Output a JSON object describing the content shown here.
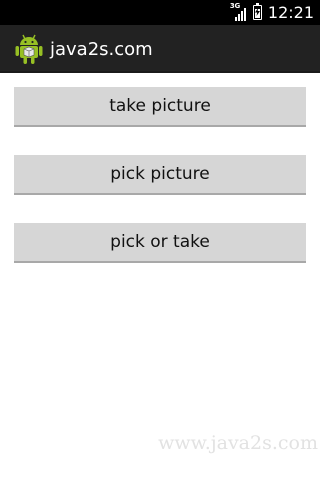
{
  "status_bar": {
    "network_type": "3G",
    "time": "12:21",
    "battery_level": 0.85
  },
  "action_bar": {
    "title": "java2s.com",
    "icon": "android-icon"
  },
  "buttons": [
    {
      "label": "take picture"
    },
    {
      "label": "pick picture"
    },
    {
      "label": "pick or take"
    }
  ],
  "watermark": "www.java2s.com",
  "colors": {
    "status_bar_bg": "#000000",
    "action_bar_bg": "#222222",
    "button_bg": "#d6d6d6",
    "android_green": "#97c024"
  }
}
